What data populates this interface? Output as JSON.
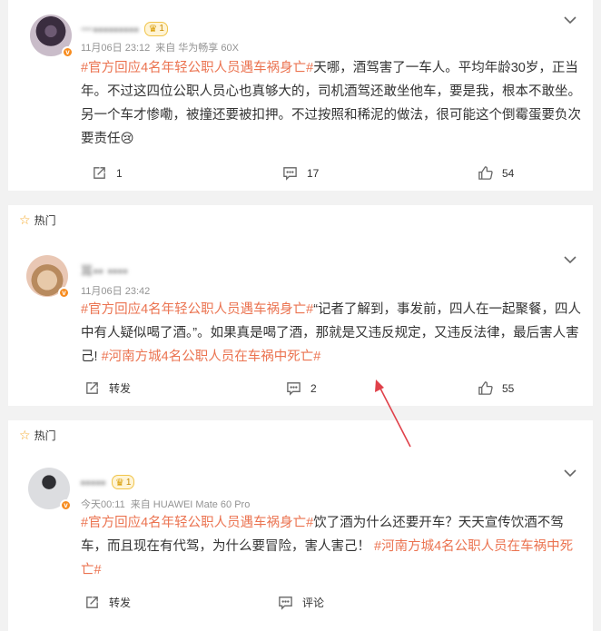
{
  "posts": [
    {
      "name_masked": "一▪▪▪▪▪▪▪▪▪",
      "time": "11月06日 23:12",
      "source": "来自 华为畅享 60X",
      "tag1": "#官方回应4名年轻公职人员遇车祸身亡#",
      "text": "天哪，酒驾害了一车人。平均年龄30岁，正当年。不过这四位公职人员心也真够大的，司机酒驾还敢坐他车，要是我，根本不敢坐。另一个车才惨嘞，被撞还要被扣押。不过按照和稀泥的做法，很可能这个倒霉蛋要负次要责任😢",
      "forward": "1",
      "comment": "17",
      "like": "54"
    },
    {
      "hot_label": "热门",
      "name_masked": "耳▪▪ ▪▪▪▪",
      "time": "11月06日 23:42",
      "tag1": "#官方回应4名年轻公职人员遇车祸身亡#",
      "text": "“记者了解到，事发前，四人在一起聚餐，四人中有人疑似喝了酒。”。如果真是喝了酒，那就是又违反规定，又违反法律，最后害人害己! ",
      "tag2": "#河南方城4名公职人员在车祸中死亡#",
      "forward": "转发",
      "comment": "2",
      "like": "55"
    },
    {
      "hot_label": "热门",
      "name_masked": "▪▪▪▪▪",
      "time": "今天00:11",
      "source": "来自 HUAWEI Mate 60 Pro",
      "tag1": "#官方回应4名年轻公职人员遇车祸身亡#",
      "text": "饮了酒为什么还要开车？天天宣传饮酒不驾车，而且现在有代驾，为什么要冒险，害人害己！",
      "tag2": "#河南方城4名公职人员在车祸中死亡#",
      "forward": "转发",
      "comment": "评论"
    }
  ],
  "colors": {
    "tag": "#eb7350",
    "arrow": "#e0414a",
    "vip": "#f78c1f"
  },
  "icons": [
    "chevron-down-icon",
    "forward-icon",
    "comment-icon",
    "like-icon",
    "star-icon",
    "crown-icon"
  ]
}
